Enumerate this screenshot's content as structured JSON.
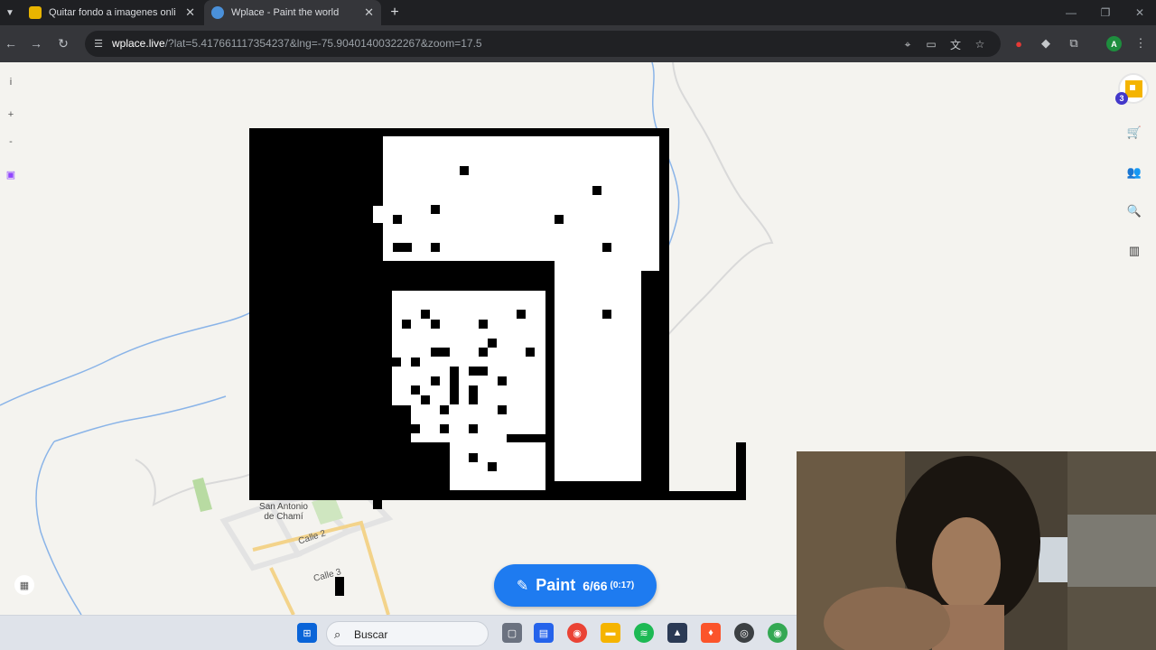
{
  "tabs": [
    {
      "title": "Quitar fondo a imagenes online",
      "active": false,
      "icon": "quitar-fondo-favicon",
      "color": "#e8b400"
    },
    {
      "title": "Wplace - Paint the world",
      "active": true,
      "icon": "globe-favicon",
      "color": "#4a90d9"
    }
  ],
  "toolbar": {
    "url_host": "wplace.live",
    "url_path": "/?lat=5.417661117354237&lng=-75.90401400322267&zoom=17.5",
    "profile_initial": "A"
  },
  "map": {
    "left_controls": [
      "i",
      "+",
      "-"
    ],
    "level": "3",
    "labels": {
      "town": "San Antonio de Chamí",
      "street1": "Calle 2",
      "street2": "Calle 3"
    }
  },
  "paint": {
    "label": "Paint",
    "count": "6/66",
    "timer": "(0:17)"
  },
  "taskbar": {
    "search_placeholder": "Buscar"
  },
  "colors": {
    "accent": "#1e7bf0",
    "pixel_black": "#000000",
    "pixel_white": "#ffffff"
  }
}
